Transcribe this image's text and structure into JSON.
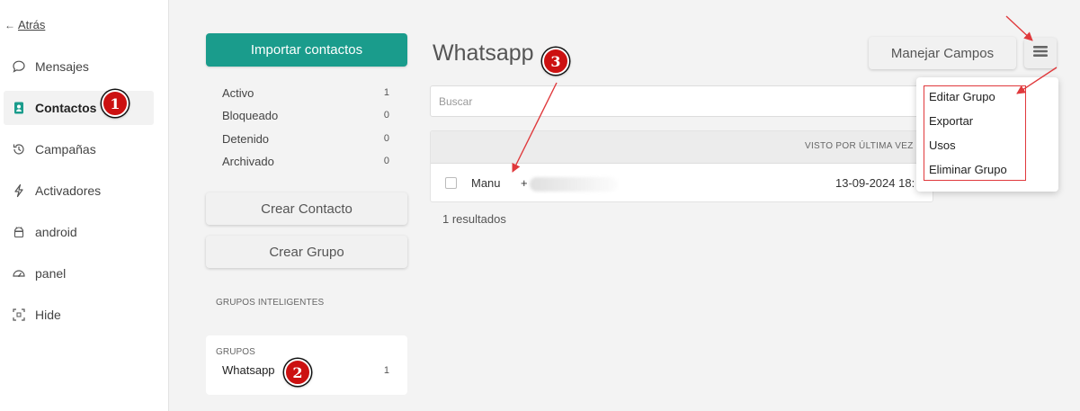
{
  "sidebar": {
    "back_label": "Atrás",
    "items": [
      {
        "label": "Mensajes",
        "icon": "chat-bubble-icon"
      },
      {
        "label": "Contactos",
        "icon": "contact-card-icon",
        "active": true
      },
      {
        "label": "Campañas",
        "icon": "history-icon"
      },
      {
        "label": "Activadores",
        "icon": "lightning-icon"
      },
      {
        "label": "android",
        "icon": "android-icon"
      },
      {
        "label": "panel",
        "icon": "dashboard-icon"
      },
      {
        "label": "Hide",
        "icon": "collapse-icon"
      }
    ]
  },
  "middle": {
    "import_label": "Importar contactos",
    "statuses": [
      {
        "label": "Activo",
        "count": "1"
      },
      {
        "label": "Bloqueado",
        "count": "0"
      },
      {
        "label": "Detenido",
        "count": "0"
      },
      {
        "label": "Archivado",
        "count": "0"
      }
    ],
    "create_contact_label": "Crear Contacto",
    "create_group_label": "Crear Grupo",
    "smart_groups_label": "GRUPOS INTELIGENTES",
    "groups_label": "GRUPOS",
    "groups": [
      {
        "label": "Whatsapp",
        "count": "1"
      }
    ]
  },
  "main": {
    "title": "Whatsapp",
    "manage_fields_label": "Manejar Campos",
    "search_placeholder": "Buscar",
    "table": {
      "last_seen_header": "VISTO POR ÚLTIMA VEZ",
      "rows": [
        {
          "name": "Manu",
          "phone_prefix": "+",
          "last_seen": "13-09-2024 18:"
        }
      ]
    },
    "results_label": "1 resultados"
  },
  "dropdown": {
    "items": [
      "Editar Grupo",
      "Exportar",
      "Usos",
      "Eliminar Grupo"
    ]
  },
  "annotations": {
    "badges": [
      "1",
      "2",
      "3"
    ],
    "accent_color": "#cc1111"
  },
  "colors": {
    "primary": "#1a9c8c",
    "annotation_red": "#e0393c"
  }
}
